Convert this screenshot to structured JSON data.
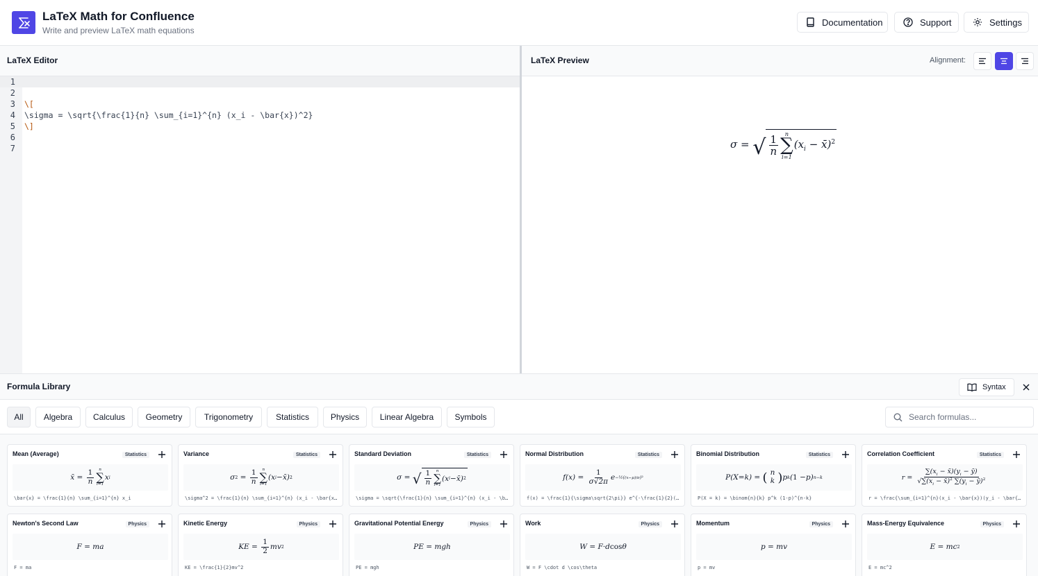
{
  "header": {
    "title": "LaTeX Math for Confluence",
    "subtitle": "Write and preview LaTeX math equations",
    "buttons": {
      "documentation": "Documentation",
      "support": "Support",
      "settings": "Settings"
    }
  },
  "editor": {
    "title": "LaTeX Editor",
    "line_numbers": [
      "1",
      "2",
      "3",
      "4",
      "5",
      "6",
      "7"
    ],
    "lines": [
      "",
      "",
      "\\[",
      "\\sigma = \\sqrt{\\frac{1}{n} \\sum_{i=1}^{n} (x_i - \\bar{x})^2}",
      "\\]",
      "",
      ""
    ]
  },
  "preview": {
    "title": "LaTeX Preview",
    "alignment_label": "Alignment:",
    "alignment_selected": "center"
  },
  "library": {
    "title": "Formula Library",
    "syntax_label": "Syntax",
    "categories": [
      "All",
      "Algebra",
      "Calculus",
      "Geometry",
      "Trigonometry",
      "Statistics",
      "Physics",
      "Linear Algebra",
      "Symbols"
    ],
    "active_category": "All",
    "search_placeholder": "Search formulas...",
    "formulas": [
      {
        "name": "Mean (Average)",
        "category": "Statistics",
        "latex": "\\bar{x} = \\frac{1}{n} \\sum_{i=1}^{n} x_i"
      },
      {
        "name": "Variance",
        "category": "Statistics",
        "latex": "\\sigma^2 = \\frac{1}{n} \\sum_{i=1}^{n} (x_i - \\bar{x})^2"
      },
      {
        "name": "Standard Deviation",
        "category": "Statistics",
        "latex": "\\sigma = \\sqrt{\\frac{1}{n} \\sum_{i=1}^{n} (x_i - \\bar{x})^2}"
      },
      {
        "name": "Normal Distribution",
        "category": "Statistics",
        "latex": "f(x) = \\frac{1}{\\sigma\\sqrt{2\\pi}} e^{-\\frac{1}{2}(\\frac{x-\\mu}{\\sigma})^2}"
      },
      {
        "name": "Binomial Distribution",
        "category": "Statistics",
        "latex": "P(X = k) = \\binom{n}{k} p^k (1-p)^{n-k}"
      },
      {
        "name": "Correlation Coefficient",
        "category": "Statistics",
        "latex": "r = \\frac{\\sum_{i=1}^{n}(x_i - \\bar{x})(y_i - \\bar{y})}{\\sqrt{\\sum_{i=1}^{n}(x_i - \\bar{x})^2 \\sum_{i=1}^{n}(y_i - \\bar{y})^2}}"
      },
      {
        "name": "Newton's Second Law",
        "category": "Physics",
        "latex": "F = ma"
      },
      {
        "name": "Kinetic Energy",
        "category": "Physics",
        "latex": "KE = \\frac{1}{2}mv^2"
      },
      {
        "name": "Gravitational Potential Energy",
        "category": "Physics",
        "latex": "PE = mgh"
      },
      {
        "name": "Work",
        "category": "Physics",
        "latex": "W = F \\cdot d \\cos\\theta"
      },
      {
        "name": "Momentum",
        "category": "Physics",
        "latex": "p = mv"
      },
      {
        "name": "Mass-Energy Equivalence",
        "category": "Physics",
        "latex": "E = mc^2"
      }
    ]
  },
  "colors": {
    "accent": "#4f46e5",
    "border": "#e5e7eb",
    "panel": "#f9fafb"
  }
}
